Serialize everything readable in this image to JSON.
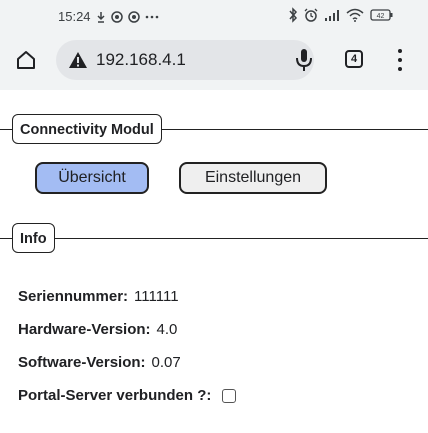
{
  "status_bar": {
    "time": "15:24"
  },
  "browser": {
    "url": "192.168.4.1",
    "tab_count": "4"
  },
  "module_section": {
    "legend": "Connectivity Modul",
    "buttons": {
      "overview_label": "Übersicht",
      "settings_label": "Einstellungen"
    }
  },
  "info_section": {
    "legend": "Info",
    "rows": [
      {
        "label": "Seriennummer:",
        "value": "111111"
      },
      {
        "label": "Hardware-Version:",
        "value": "4.0"
      },
      {
        "label": "Software-Version:",
        "value": "0.07"
      },
      {
        "label": "Portal-Server verbunden ?:",
        "value": ""
      }
    ],
    "portal_connected": false
  },
  "colors": {
    "primary_button": "#a3bcf3",
    "secondary_button": "#efefef",
    "chrome_bg": "#f1f3f4",
    "urlbar_bg": "#e3e5e8"
  }
}
